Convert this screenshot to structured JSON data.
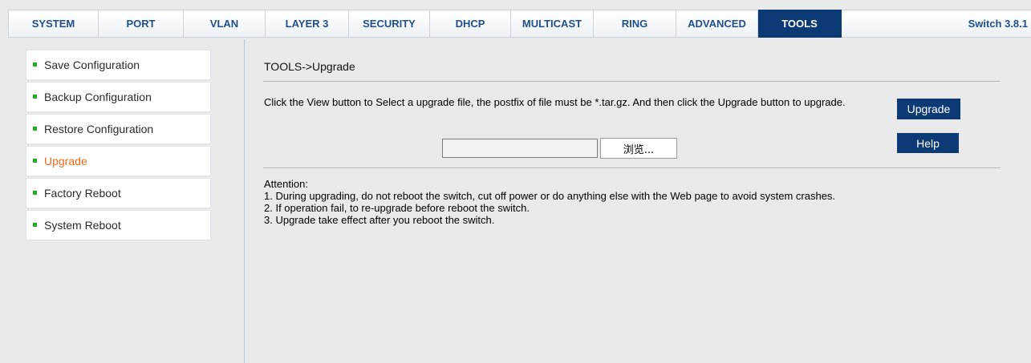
{
  "tabs": [
    {
      "label": "SYSTEM"
    },
    {
      "label": "PORT"
    },
    {
      "label": "VLAN"
    },
    {
      "label": "LAYER 3"
    },
    {
      "label": "SECURITY"
    },
    {
      "label": "DHCP"
    },
    {
      "label": "MULTICAST"
    },
    {
      "label": "RING"
    },
    {
      "label": "ADVANCED"
    },
    {
      "label": "TOOLS",
      "active": true
    }
  ],
  "version": "Switch 3.8.1",
  "sidebar": {
    "items": [
      {
        "label": "Save Configuration"
      },
      {
        "label": "Backup Configuration"
      },
      {
        "label": "Restore Configuration"
      },
      {
        "label": "Upgrade",
        "active": true
      },
      {
        "label": "Factory Reboot"
      },
      {
        "label": "System Reboot"
      }
    ]
  },
  "main": {
    "breadcrumb": "TOOLS->Upgrade",
    "instruction": "Click the View button to Select a upgrade file, the postfix of file must be *.tar.gz. And then click the Upgrade button to upgrade.",
    "upgrade_label": "Upgrade",
    "help_label": "Help",
    "file_value": "",
    "browse_label": "浏览...",
    "attention": {
      "title": "Attention:",
      "lines": [
        "1. During upgrading, do not reboot the switch, cut off power or do anything else with the Web page to avoid system crashes.",
        "2. If operation fail, to re-upgrade before reboot the switch.",
        "3. Upgrade take effect after you reboot the switch."
      ]
    }
  },
  "colors": {
    "accent": "#0b3a75",
    "tab_text": "#1f4e8c",
    "active_item": "#ee6a14",
    "bullet": "#1fae1f"
  }
}
